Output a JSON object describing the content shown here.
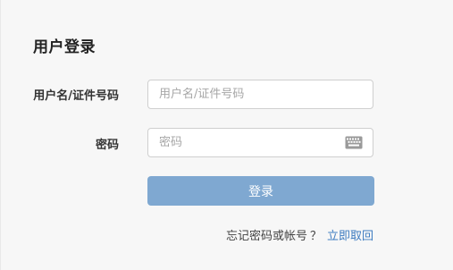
{
  "form": {
    "title": "用户登录",
    "username_label": "用户名/证件号码",
    "username_placeholder": "用户名/证件号码",
    "username_value": "",
    "password_label": "密码",
    "password_placeholder": "密码",
    "password_value": "",
    "keyboard_icon": "keyboard-icon",
    "login_button": "登录",
    "forgot_text": "忘记密码或帐号",
    "forgot_question_mark": "？",
    "retrieve_link": "立即取回"
  },
  "colors": {
    "button_bg": "#7fa8d1",
    "link": "#3e7cc0",
    "panel_bg": "#f7f7f7"
  }
}
